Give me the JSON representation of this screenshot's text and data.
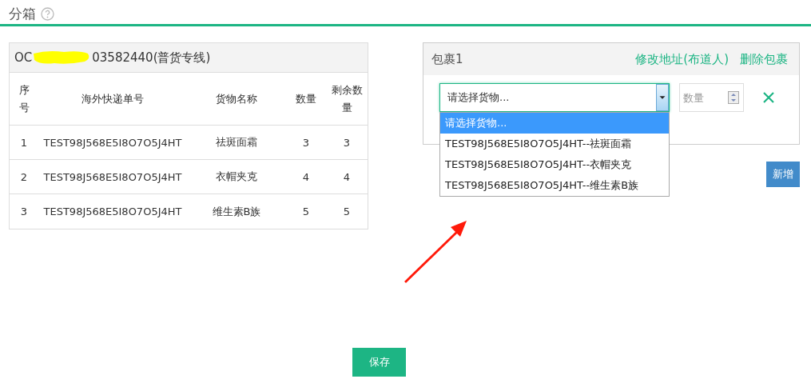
{
  "page_title": "分箱",
  "order": {
    "id_start": "OC",
    "id_end": "03582440(普货专线)",
    "columns": [
      "序号",
      "海外快递单号",
      "货物名称",
      "数量",
      "剩余数量"
    ],
    "rows": [
      {
        "no": "1",
        "tracking": "TEST98J568E5I8O7O5J4HT",
        "goods": "祛斑面霜",
        "qty": "3",
        "remaining": "3"
      },
      {
        "no": "2",
        "tracking": "TEST98J568E5I8O7O5J4HT",
        "goods": "衣帽夹克",
        "qty": "4",
        "remaining": "4"
      },
      {
        "no": "3",
        "tracking": "TEST98J568E5I8O7O5J4HT",
        "goods": "维生素B族",
        "qty": "5",
        "remaining": "5"
      }
    ]
  },
  "package": {
    "title": "包裹1",
    "links": [
      "修改地址(布道人)",
      "删除包裹"
    ],
    "select": {
      "value": "请选择货物...",
      "expanded": true,
      "options": [
        {
          "label": "请选择货物...",
          "selected": true
        },
        {
          "label": "TEST98J568E5I8O7O5J4HT--祛斑面霜",
          "selected": false
        },
        {
          "label": "TEST98J568E5I8O7O5J4HT--衣帽夹克",
          "selected": false
        },
        {
          "label": "TEST98J568E5I8O7O5J4HT--维生素B族",
          "selected": false
        }
      ]
    },
    "quantity": {
      "placeholder": "数量"
    }
  },
  "add_button": "新增",
  "save_button": "保存"
}
